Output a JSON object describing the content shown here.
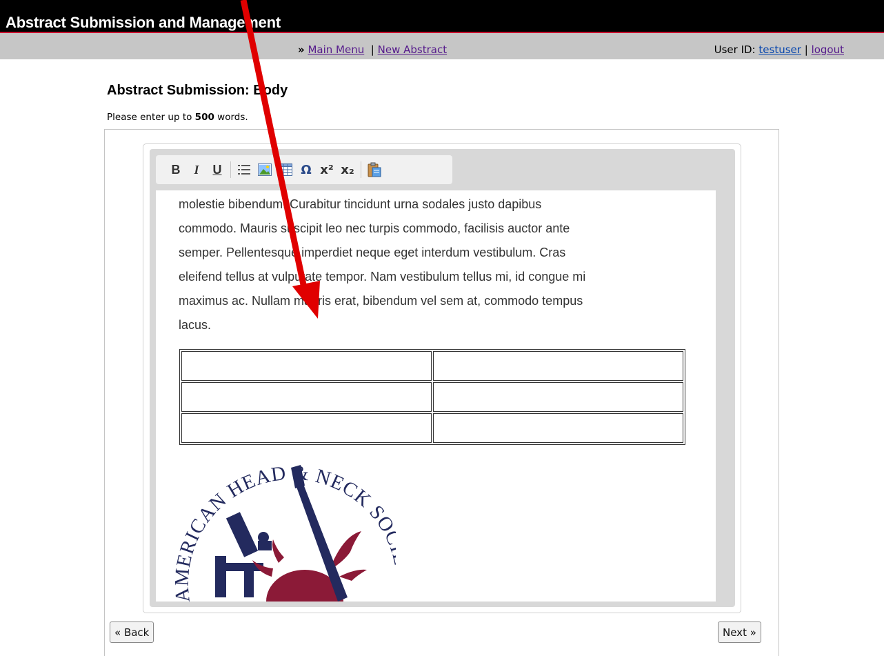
{
  "header": {
    "title": "Abstract Submission and Management"
  },
  "nav": {
    "prefix": "»",
    "main_menu": "Main Menu",
    "separator": "|",
    "new_abstract": "New Abstract",
    "user_label": "User ID:",
    "user_id": "testuser",
    "logout": "logout"
  },
  "page": {
    "heading": "Abstract Submission: Body",
    "instructions_pre": "Please enter up to ",
    "word_limit": "500",
    "instructions_post": " words."
  },
  "editor": {
    "toolbar": [
      {
        "name": "bold-button",
        "glyph": "B",
        "icon": "bold-icon"
      },
      {
        "name": "italic-button",
        "glyph": "I",
        "icon": "italic-icon"
      },
      {
        "name": "underline-button",
        "glyph": "U",
        "icon": "underline-icon"
      },
      {
        "name": "bullet-list-button",
        "glyph": "",
        "icon": "bullet-list-icon"
      },
      {
        "name": "insert-image-button",
        "glyph": "",
        "icon": "image-icon"
      },
      {
        "name": "insert-table-button",
        "glyph": "",
        "icon": "table-icon"
      },
      {
        "name": "special-character-button",
        "glyph": "Ω",
        "icon": "omega-icon"
      },
      {
        "name": "superscript-button",
        "glyph": "x²",
        "icon": "superscript-icon"
      },
      {
        "name": "subscript-button",
        "glyph": "x₂",
        "icon": "subscript-icon"
      },
      {
        "name": "paste-button",
        "glyph": "",
        "icon": "paste-icon"
      }
    ],
    "body_lines": [
      "molestie bibendum. Curabitur tincidunt urna sodales justo dapibus",
      "commodo. Mauris suscipit leo nec turpis commodo, facilisis auctor ante",
      "semper. Pellentesque imperdiet neque eget interdum vestibulum. Cras",
      "eleifend tellus at vulputate tempor. Nam vestibulum tellus mi, id congue mi",
      "maximus ac. Nullam mauris erat, bibendum vel sem at, commodo tempus",
      "lacus."
    ],
    "table": {
      "rows": 3,
      "cols": 2
    },
    "logo_text": "American Head & Neck Society",
    "scroll": {
      "up_icon": "chevron-up-icon",
      "down_icon": "chevron-down-icon"
    }
  },
  "buttons": {
    "back": "« Back",
    "next": "Next »"
  },
  "colors": {
    "header_bg": "#000000",
    "accent_red": "#c8102e",
    "nav_bg": "#c6c6c6",
    "logo_navy": "#232a5e",
    "logo_crimson": "#8b1a37",
    "annotation_arrow": "#e00000"
  }
}
